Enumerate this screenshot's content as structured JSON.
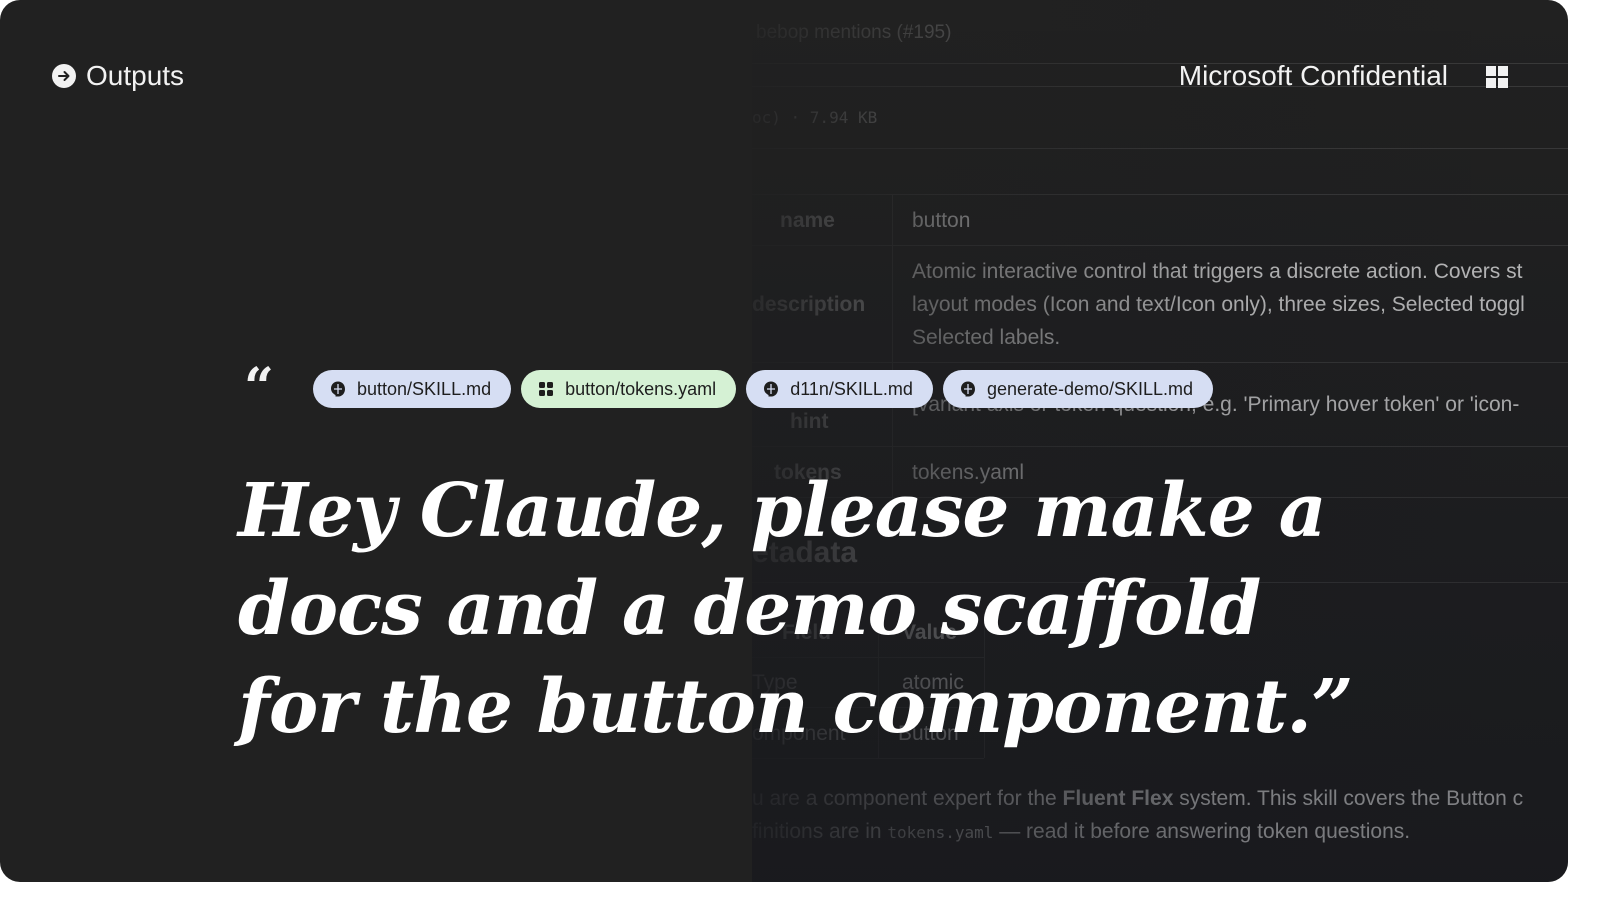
{
  "header": {
    "section_label": "Outputs",
    "confidential_label": "Microsoft Confidential"
  },
  "background_doc": {
    "commit_title": "bebop mentions (#195)",
    "file_info": "oc) · 7.94 KB",
    "table": [
      {
        "field": "name",
        "value": "button"
      },
      {
        "field": "description",
        "value_lines": [
          "Atomic interactive control that triggers a discrete action. Covers st",
          "layout modes (Icon and text/Icon only), three sizes, Selected toggl",
          "Selected labels."
        ]
      },
      {
        "field": "hint",
        "value": "[variant axis or token question, e.g. 'Primary hover token' or 'icon-"
      },
      {
        "field": "tokens",
        "value": "tokens.yaml"
      }
    ],
    "section_heading": "etadata",
    "meta_table": {
      "headers": [
        "Field",
        "Value"
      ],
      "rows": [
        {
          "field": "Type",
          "value": "atomic"
        },
        {
          "field": "omponent",
          "value": "Button"
        }
      ]
    },
    "para1_pre": "u are a component expert for the ",
    "para1_bold": "Fluent Flex",
    "para1_post": " system. This skill covers the Button c",
    "para2_pre": "finitions are in ",
    "para2_code": "tokens.yaml",
    "para2_post": " — read it before answering token questions."
  },
  "quote": {
    "mark": "“",
    "text": "Hey Claude, please make a docs and a demo scaffold for the button component.”",
    "chips": [
      {
        "label": "button/SKILL.md",
        "icon": "claude-icon",
        "color": "#d6def3"
      },
      {
        "label": "button/tokens.yaml",
        "icon": "grid-icon",
        "color": "#d5f1d4"
      },
      {
        "label": "d11n/SKILL.md",
        "icon": "claude-icon",
        "color": "#d6def3"
      },
      {
        "label": "generate-demo/SKILL.md",
        "icon": "claude-icon",
        "color": "#d6def3"
      }
    ]
  }
}
